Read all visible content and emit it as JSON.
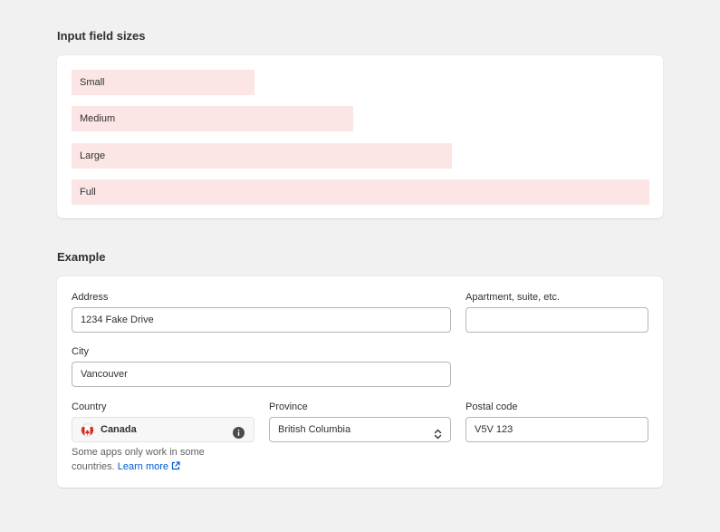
{
  "sizes": {
    "title": "Input field sizes",
    "small": "Small",
    "medium": "Medium",
    "large": "Large",
    "full": "Full"
  },
  "example": {
    "title": "Example",
    "address": {
      "label": "Address",
      "value": "1234 Fake Drive"
    },
    "apartment": {
      "label": "Apartment, suite, etc.",
      "value": ""
    },
    "city": {
      "label": "City",
      "value": "Vancouver"
    },
    "country": {
      "label": "Country",
      "value": "Canada",
      "flag_icon": "canada-flag-icon",
      "info_icon": "info-icon"
    },
    "province": {
      "label": "Province",
      "value": "British Columbia",
      "selector_icon": "select-arrows-icon"
    },
    "postal": {
      "label": "Postal code",
      "value": "V5V 123"
    },
    "help_text": "Some apps only work in some countries.",
    "learn_more": "Learn more",
    "external_icon": "external-link-icon"
  },
  "colors": {
    "size_highlight": "#fce5e5",
    "link": "#005bd3",
    "background": "#f1f1f1"
  }
}
